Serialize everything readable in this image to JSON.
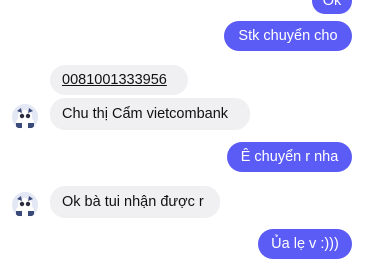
{
  "messages": [
    {
      "id": 0,
      "direction": "outgoing",
      "text": "Ok"
    },
    {
      "id": 1,
      "direction": "outgoing",
      "text": "Stk chuyển cho"
    },
    {
      "id": 2,
      "direction": "incoming",
      "text": "0081001333956",
      "underlined": true
    },
    {
      "id": 3,
      "direction": "incoming",
      "text": "Chu thị Cẩm vietcombank"
    },
    {
      "id": 4,
      "direction": "outgoing",
      "text": "Ê chuyển r nha"
    },
    {
      "id": 5,
      "direction": "incoming",
      "text": "Ok bà tui nhận được r"
    },
    {
      "id": 6,
      "direction": "outgoing",
      "text": "Ủa lẹ v :)))"
    }
  ],
  "colors": {
    "outgoing_bubble": "#5b5bf5",
    "incoming_bubble": "#f0f0f2",
    "background": "#ffffff"
  },
  "icons": {
    "contact_avatar": "contact-avatar-icon"
  }
}
